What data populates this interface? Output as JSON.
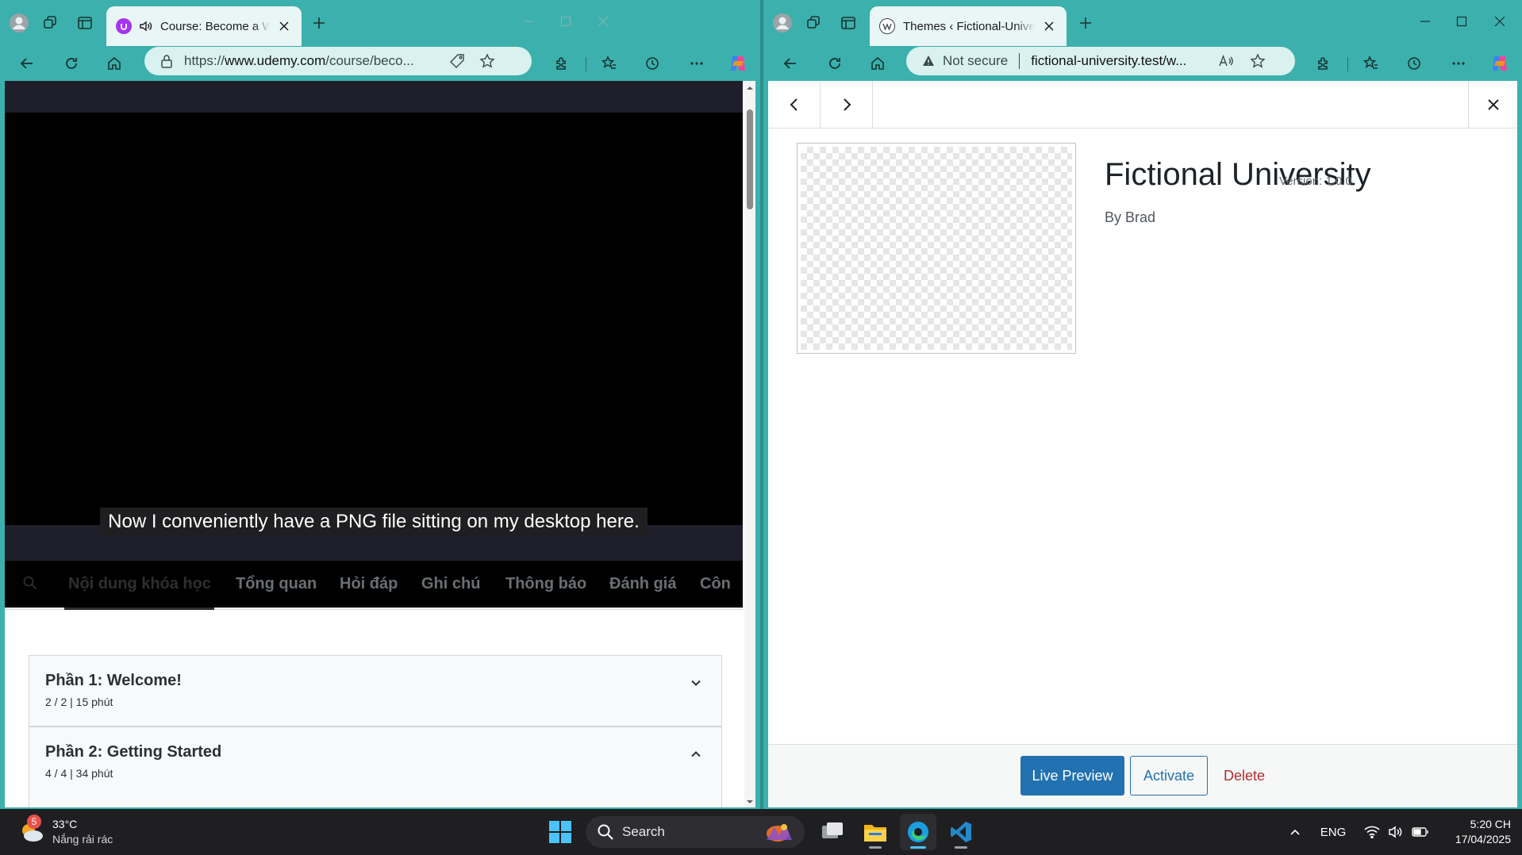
{
  "left_window": {
    "tab_title": "Course: Become a WordPress Developer",
    "address": {
      "prefix": "https://",
      "host": "www.udemy.com",
      "path": "/course/beco..."
    },
    "caption": "Now I conveniently have a PNG file sitting on my desktop here.",
    "content_tabs": [
      "Nội dung khóa học",
      "Tổng quan",
      "Hỏi đáp",
      "Ghi chú",
      "Thông báo",
      "Đánh giá",
      "Côn"
    ],
    "sections": [
      {
        "title": "Phần 1: Welcome!",
        "meta": "2 / 2 | 15 phút",
        "expanded": false
      },
      {
        "title": "Phần 2: Getting Started",
        "meta": "4 / 4 | 34 phút",
        "expanded": true
      }
    ],
    "accent": "#a435f0"
  },
  "right_window": {
    "tab_title": "Themes ‹ Fictional-University — WordPress",
    "address": {
      "warning": "Not secure",
      "host": "fictional-university.test",
      "path": "/w..."
    },
    "theme": {
      "name": "Fictional University",
      "version": "Version: 1.0.0",
      "author": "By Brad"
    },
    "buttons": {
      "live_preview": "Live Preview",
      "activate": "Activate",
      "delete": "Delete"
    },
    "accent": "#2271b1"
  },
  "taskbar": {
    "weather_temp": "33°C",
    "weather_desc": "Nắng rải rác",
    "weather_badge": "5",
    "search_placeholder": "Search",
    "language": "ENG",
    "time": "5:20 CH",
    "date": "17/04/2025",
    "apps": [
      "start-icon",
      "task-view-icon",
      "file-explorer-icon",
      "edge-icon",
      "vscode-icon"
    ]
  }
}
